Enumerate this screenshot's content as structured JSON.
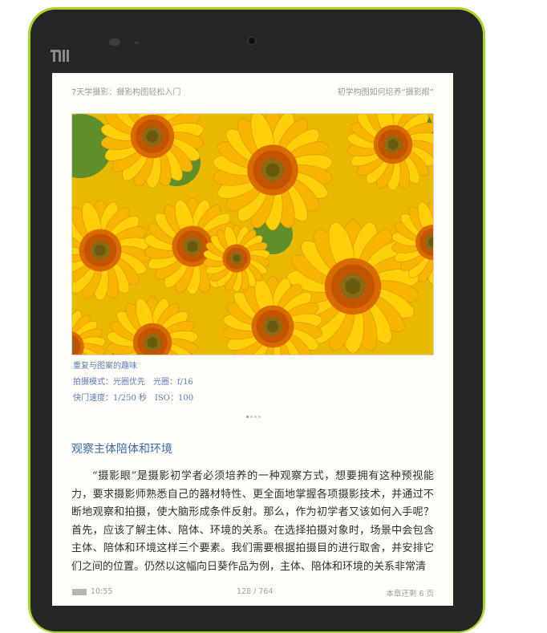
{
  "device": {
    "brand_logo": "MI",
    "icons": [
      "mi-logo-icon",
      "front-camera-icon",
      "light-sensor-icon",
      "battery-icon"
    ],
    "colors": {
      "frame": "#a8d428",
      "bezel": "#262626",
      "paper": "#fffdf8",
      "accent": "#3a6aac"
    }
  },
  "reader": {
    "book_title": "7天学摄影：摄影构图轻松入门",
    "chapter_title": "初学构图如何培养“摄影眼”",
    "figure": {
      "image_subject": "sunflowers",
      "caption": "重复与图案的趣味",
      "shooting_mode": "拍摄模式：光圈优先　光圈：f/16",
      "shutter_iso": "快门速度：1/250 秒　ISO：100"
    },
    "section_heading": "观察主体陪体和环境",
    "paragraph": "“摄影眼”是摄影初学者必须培养的一种观察方式，想要拥有这种预视能力，要求摄影师熟悉自己的器材特性、更全面地掌握各项摄影技术，并通过不断地观察和拍摄，使大脑形成条件反射。那么，作为初学者又该如何入手呢？首先，应该了解主体、陪体、环境的关系。在选择拍摄对象时，场景中会包含主体、陪体和环境这样三个要素。我们需要根据拍摄目的进行取舍，并安排它们之间的位置。仍然以这幅向日葵作品为例，主体、陪体和环境的关系非常清",
    "status": {
      "time": "10:55",
      "page_position": "128 / 764",
      "chapter_remaining": "本章还剩 6 页"
    }
  }
}
